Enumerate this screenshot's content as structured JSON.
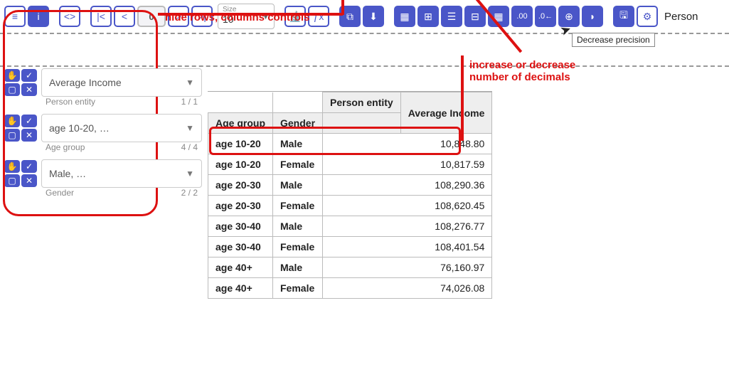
{
  "toolbar": {
    "size_label": "Size",
    "size_value": "10",
    "page_number": "0",
    "entity_label": "Person",
    "tooltip": "Decrease precision"
  },
  "annotations": {
    "hide_rows": "hide rows, columns controls",
    "decimals": "increase or decrease\nnumber of decimals"
  },
  "panels": [
    {
      "value": "Average Income",
      "sub_label": "Person entity",
      "count": "1 / 1"
    },
    {
      "value": "age 10-20, …",
      "sub_label": "Age group",
      "count": "4 / 4"
    },
    {
      "value": "Male, …",
      "sub_label": "Gender",
      "count": "2 / 2"
    }
  ],
  "table": {
    "col_entity": "Person entity",
    "col_measure": "Average Income",
    "row_header1": "Age group",
    "row_header2": "Gender",
    "rows": [
      {
        "age": "age 10-20",
        "gender": "Male",
        "value": "10,848.80"
      },
      {
        "age": "age 10-20",
        "gender": "Female",
        "value": "10,817.59"
      },
      {
        "age": "age 20-30",
        "gender": "Male",
        "value": "108,290.36"
      },
      {
        "age": "age 20-30",
        "gender": "Female",
        "value": "108,620.45"
      },
      {
        "age": "age 30-40",
        "gender": "Male",
        "value": "108,276.77"
      },
      {
        "age": "age 30-40",
        "gender": "Female",
        "value": "108,401.54"
      },
      {
        "age": "age 40+",
        "gender": "Male",
        "value": "76,160.97"
      },
      {
        "age": "age 40+",
        "gender": "Female",
        "value": "74,026.08"
      }
    ]
  }
}
